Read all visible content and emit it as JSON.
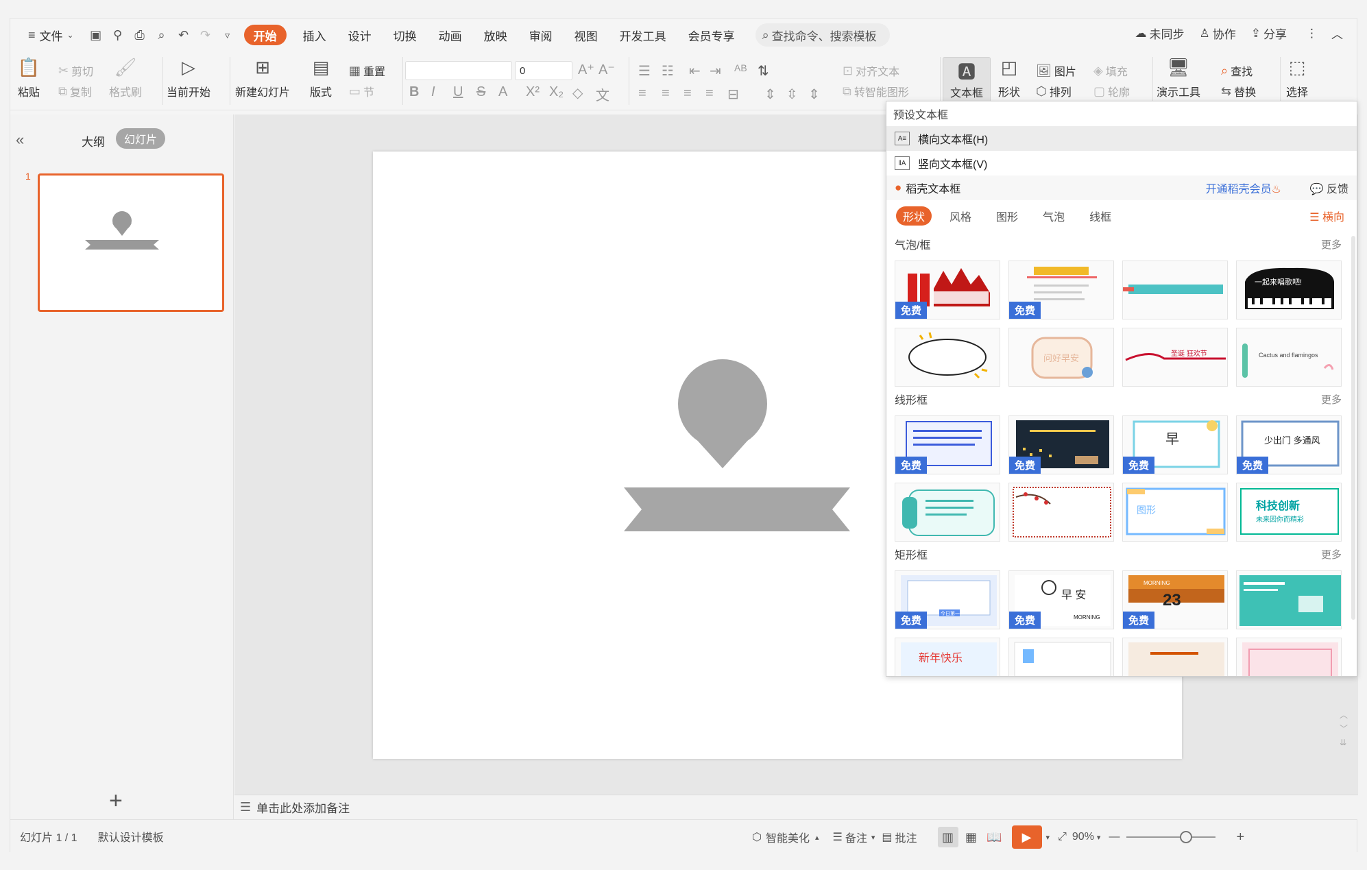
{
  "menu": {
    "file_label": "文件",
    "tabs": [
      "开始",
      "插入",
      "设计",
      "切换",
      "动画",
      "放映",
      "审阅",
      "视图",
      "开发工具",
      "会员专享"
    ],
    "search_placeholder": "查找命令、搜索模板",
    "sync_label": "未同步",
    "collab_label": "协作",
    "share_label": "分享"
  },
  "ribbon": {
    "paste": "粘贴",
    "cut": "剪切",
    "copy": "复制",
    "format_painter": "格式刷",
    "start_show": "当前开始",
    "new_slide": "新建幻灯片",
    "layout": "版式",
    "reset": "重置",
    "section": "节",
    "font_size": "0",
    "align_text": "对齐文本",
    "smart_convert": "转智能图形",
    "textbox": "文本框",
    "shape": "形状",
    "picture": "图片",
    "fill": "填充",
    "arrange": "排列",
    "outline": "轮廓",
    "present_tools": "演示工具",
    "find": "查找",
    "replace": "替换",
    "select": "选择"
  },
  "leftpanel": {
    "outline_tab": "大纲",
    "slides_tab": "幻灯片",
    "slide_number": "1"
  },
  "notes": {
    "placeholder": "单击此处添加备注"
  },
  "statusbar": {
    "slide_info": "幻灯片 1 / 1",
    "template": "默认设计模板",
    "beautify": "智能美化",
    "notes": "备注",
    "comment": "批注",
    "zoom": "90%"
  },
  "dropdown": {
    "preset_header": "预设文本框",
    "horizontal": "横向文本框(H)",
    "vertical": "竖向文本框(V)",
    "daoke_label": "稻壳文本框",
    "vip_label": "开通稻壳会员",
    "feedback": "反馈",
    "categories": [
      "形状",
      "风格",
      "图形",
      "气泡",
      "线框"
    ],
    "orientation": "横向",
    "free_badge": "免费",
    "more": "更多",
    "sections": {
      "bubble": "气泡/框",
      "line": "线形框",
      "rect": "矩形框"
    },
    "tile_texts": {
      "piano": "一起来唱歌吧!",
      "christmas": "圣诞 狂欢节",
      "cactus": "Cactus and flamingos",
      "morning_zao": "早",
      "morning_an": "早 安",
      "shao_chumen": "少出门 多通风",
      "tuxing": "图形",
      "keji": "科技创新",
      "weilai": "未来因你而精彩",
      "morning": "MORNING",
      "num23": "23",
      "jinri": "今日第一",
      "xinnian": "新年快乐",
      "wenhao": "问好早安"
    }
  }
}
